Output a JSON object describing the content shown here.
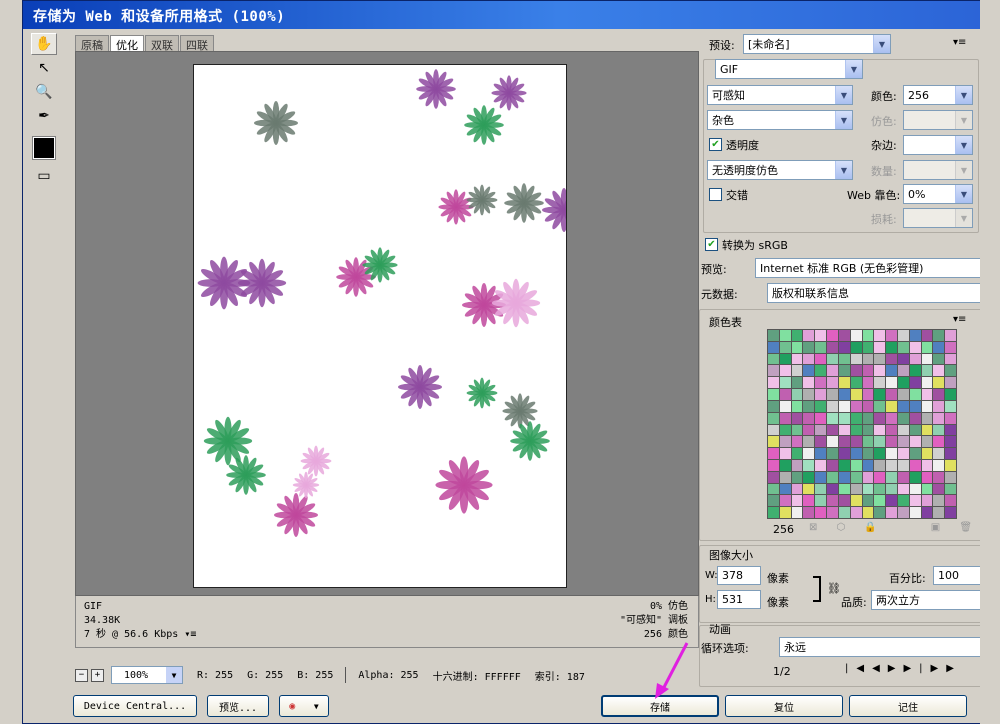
{
  "title": "存储为 Web 和设备所用格式 (100%)",
  "tabs": [
    "原稿",
    "优化",
    "双联",
    "四联"
  ],
  "active_tab": 1,
  "tools": [
    "hand-icon",
    "slice-select-icon",
    "zoom-icon",
    "eyedropper-icon"
  ],
  "info": {
    "format": "GIF",
    "size": "34.38K",
    "time": "7 秒 @ 56.6 Kbps",
    "dither": "0% 仿色",
    "palette": "\"可感知\" 调板",
    "colors": "256 颜色"
  },
  "status": {
    "zoom": "100%",
    "r": "R: 255",
    "g": "G: 255",
    "b": "B: 255",
    "alpha": "Alpha: 255",
    "hex": "十六进制: FFFFFF",
    "index": "索引: 187"
  },
  "buttons": {
    "device_central": "Device Central...",
    "preview": "预览...",
    "save": "存储",
    "reset": "复位",
    "remember": "记住"
  },
  "settings": {
    "preset_label": "预设:",
    "preset_value": "[未命名]",
    "format_value": "GIF",
    "reduction_value": "可感知",
    "colors_label": "颜色:",
    "colors_value": "256",
    "dither_algo_value": "杂色",
    "dither_label": "仿色:",
    "transparency_label": "透明度",
    "matte_label": "杂边:",
    "trans_dither_value": "无透明度仿色",
    "amount_label": "数量:",
    "interlace_label": "交错",
    "websnap_label": "Web 靠色:",
    "websnap_value": "0%",
    "lossy_label": "损耗:",
    "srgb_label": "转换为 sRGB",
    "preview_label": "预览:",
    "preview_value": "Internet 标准 RGB (无色彩管理)",
    "metadata_label": "元数据:",
    "metadata_value": "版权和联系信息"
  },
  "color_table": {
    "title": "颜色表",
    "count": "256"
  },
  "image_size": {
    "title": "图像大小",
    "w_label": "W:",
    "w_value": "378",
    "h_label": "H:",
    "h_value": "531",
    "unit": "像素",
    "percent_label": "百分比:",
    "percent_value": "100",
    "percent_unit": "%",
    "quality_label": "品质:",
    "quality_value": "两次立方"
  },
  "animation": {
    "title": "动画",
    "loop_label": "循环选项:",
    "loop_value": "永远",
    "frame": "1/2"
  },
  "colors": {
    "pink": "#c0489c",
    "purple": "#8e4aa0",
    "green": "#2e9e5a",
    "grey_green": "#6a7a70",
    "light_pink": "#e8a8dc"
  }
}
